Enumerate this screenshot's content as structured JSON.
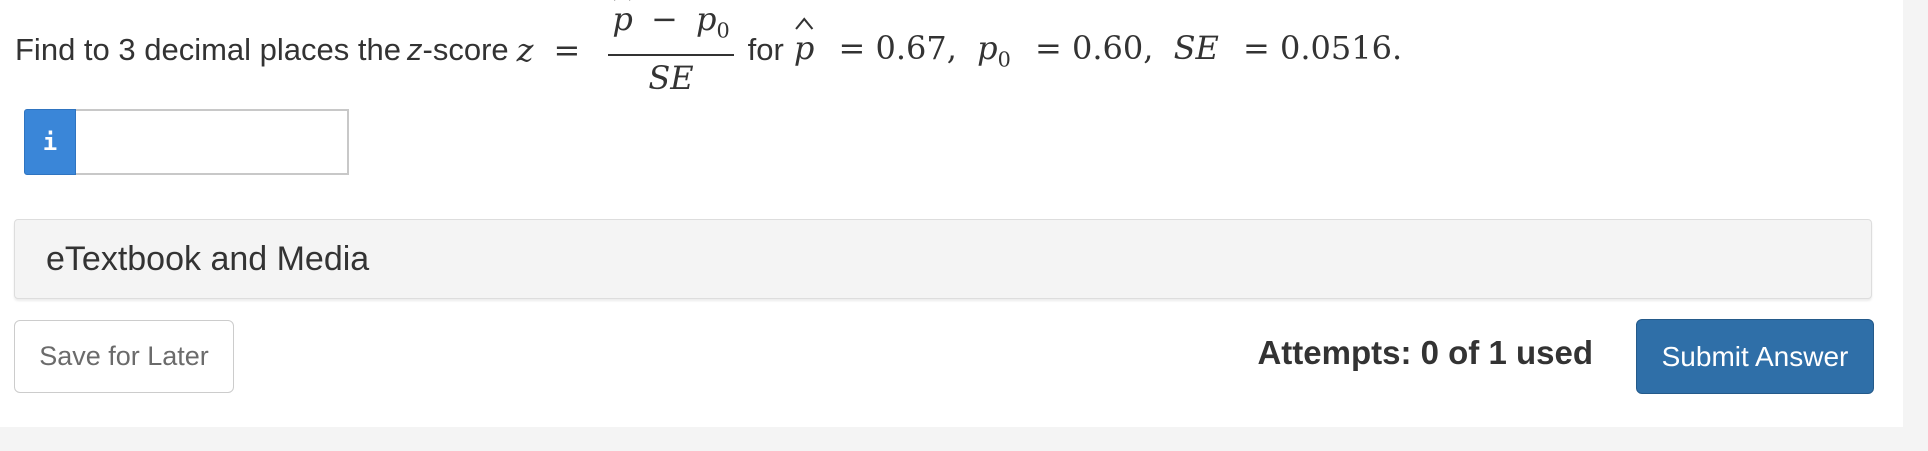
{
  "question": {
    "prefix": "Find to 3 decimal places the",
    "z_italic": "z",
    "suffix_score": "-score",
    "z_symbol": "z",
    "equals": "=",
    "num_p": "p",
    "num_minus": "−",
    "num_p0": "p",
    "num_p0_sub": "0",
    "den": "SE",
    "for_word": "for",
    "p_hat": "p",
    "val1": "= 0.67,",
    "p0_label": "p",
    "p0_sub": "0",
    "val2": "= 0.60,",
    "se_label": "SE",
    "val3": "= 0.0516."
  },
  "answer": {
    "info_icon_glyph": "i",
    "input_value": "",
    "input_placeholder": ""
  },
  "etextbook": {
    "label": "eTextbook and Media"
  },
  "footer": {
    "save_label": "Save for Later",
    "attempts_text": "Attempts: 0 of 1 used",
    "submit_label": "Submit Answer"
  },
  "colors": {
    "info_blue": "#3a86d8",
    "submit_blue": "#2f6fa8",
    "text": "#333333"
  },
  "icons": {
    "info": "info-icon"
  }
}
